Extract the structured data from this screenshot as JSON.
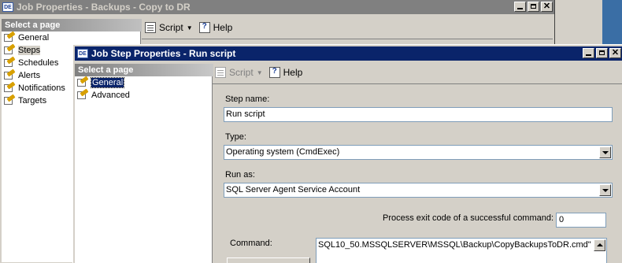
{
  "back_window": {
    "title": "Job Properties - Backups - Copy to DR",
    "select_page_label": "Select a page",
    "pages": [
      "General",
      "Steps",
      "Schedules",
      "Alerts",
      "Notifications",
      "Targets"
    ],
    "selected_page": "Steps",
    "toolbar": {
      "script_label": "Script",
      "help_label": "Help"
    }
  },
  "front_window": {
    "title": "Job Step Properties - Run script",
    "select_page_label": "Select a page",
    "pages": [
      "General",
      "Advanced"
    ],
    "selected_page": "General",
    "toolbar": {
      "script_label": "Script",
      "help_label": "Help"
    },
    "form": {
      "step_name_label": "Step name:",
      "step_name_value": "Run script",
      "type_label": "Type:",
      "type_value": "Operating system (CmdExec)",
      "run_as_label": "Run as:",
      "run_as_value": "SQL Server Agent Service Account",
      "exit_code_label": "Process exit code of a successful command:",
      "exit_code_value": "0",
      "command_label": "Command:",
      "command_value": "SQL10_50.MSSQLSERVER\\MSSQL\\Backup\\CopyBackupsToDR.cmd\""
    }
  },
  "icons": {
    "app": "sql-app-icon",
    "page": "page-icon",
    "script": "script-icon",
    "help": "help-icon"
  },
  "colors": {
    "active_title": "#0a246a",
    "inactive_title": "#808080",
    "face": "#d4d0c8",
    "desktop_accent": "#3a6ea5"
  }
}
